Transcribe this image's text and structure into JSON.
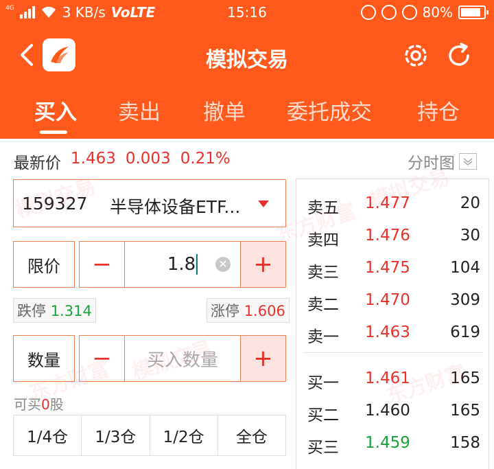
{
  "status_bar": {
    "network_type": "4G",
    "speed": "3 KB/s",
    "volte": "VoLTE",
    "time": "15:16",
    "battery": "80%"
  },
  "header": {
    "title": "模拟交易",
    "tabs": [
      "买入",
      "卖出",
      "撤单",
      "委托成交",
      "持仓"
    ],
    "active_tab": "买入",
    "accent_color": "#ff5a1c"
  },
  "quote": {
    "label": "最新价",
    "price": "1.463",
    "change": "0.003",
    "change_pct": "0.21%",
    "chart_link": "分时图"
  },
  "stock": {
    "code": "159327",
    "name": "半导体设备ETF..."
  },
  "price_entry": {
    "type_label": "限价",
    "value": "1.8",
    "minus": "−",
    "plus": "+",
    "limit_down_label": "跌停",
    "limit_down": "1.314",
    "limit_up_label": "涨停",
    "limit_up": "1.606"
  },
  "quantity_entry": {
    "label": "数量",
    "placeholder": "买入数量",
    "minus": "−",
    "plus": "+"
  },
  "can_buy": {
    "prefix": "可买",
    "count": "0",
    "suffix": "股"
  },
  "ratios": [
    "1/4仓",
    "1/3仓",
    "1/2仓",
    "全仓"
  ],
  "order_book": {
    "asks": [
      {
        "label": "卖五",
        "price": "1.477",
        "volume": "20"
      },
      {
        "label": "卖四",
        "price": "1.476",
        "volume": "30"
      },
      {
        "label": "卖三",
        "price": "1.475",
        "volume": "104"
      },
      {
        "label": "卖二",
        "price": "1.470",
        "volume": "309"
      },
      {
        "label": "卖一",
        "price": "1.463",
        "volume": "619"
      }
    ],
    "bids": [
      {
        "label": "买一",
        "price": "1.461",
        "volume": "165",
        "color": "red"
      },
      {
        "label": "买二",
        "price": "1.460",
        "volume": "165",
        "color": "neutral"
      },
      {
        "label": "买三",
        "price": "1.459",
        "volume": "158",
        "color": "green"
      }
    ]
  },
  "watermarks": [
    "东方财富",
    "模拟交易"
  ]
}
